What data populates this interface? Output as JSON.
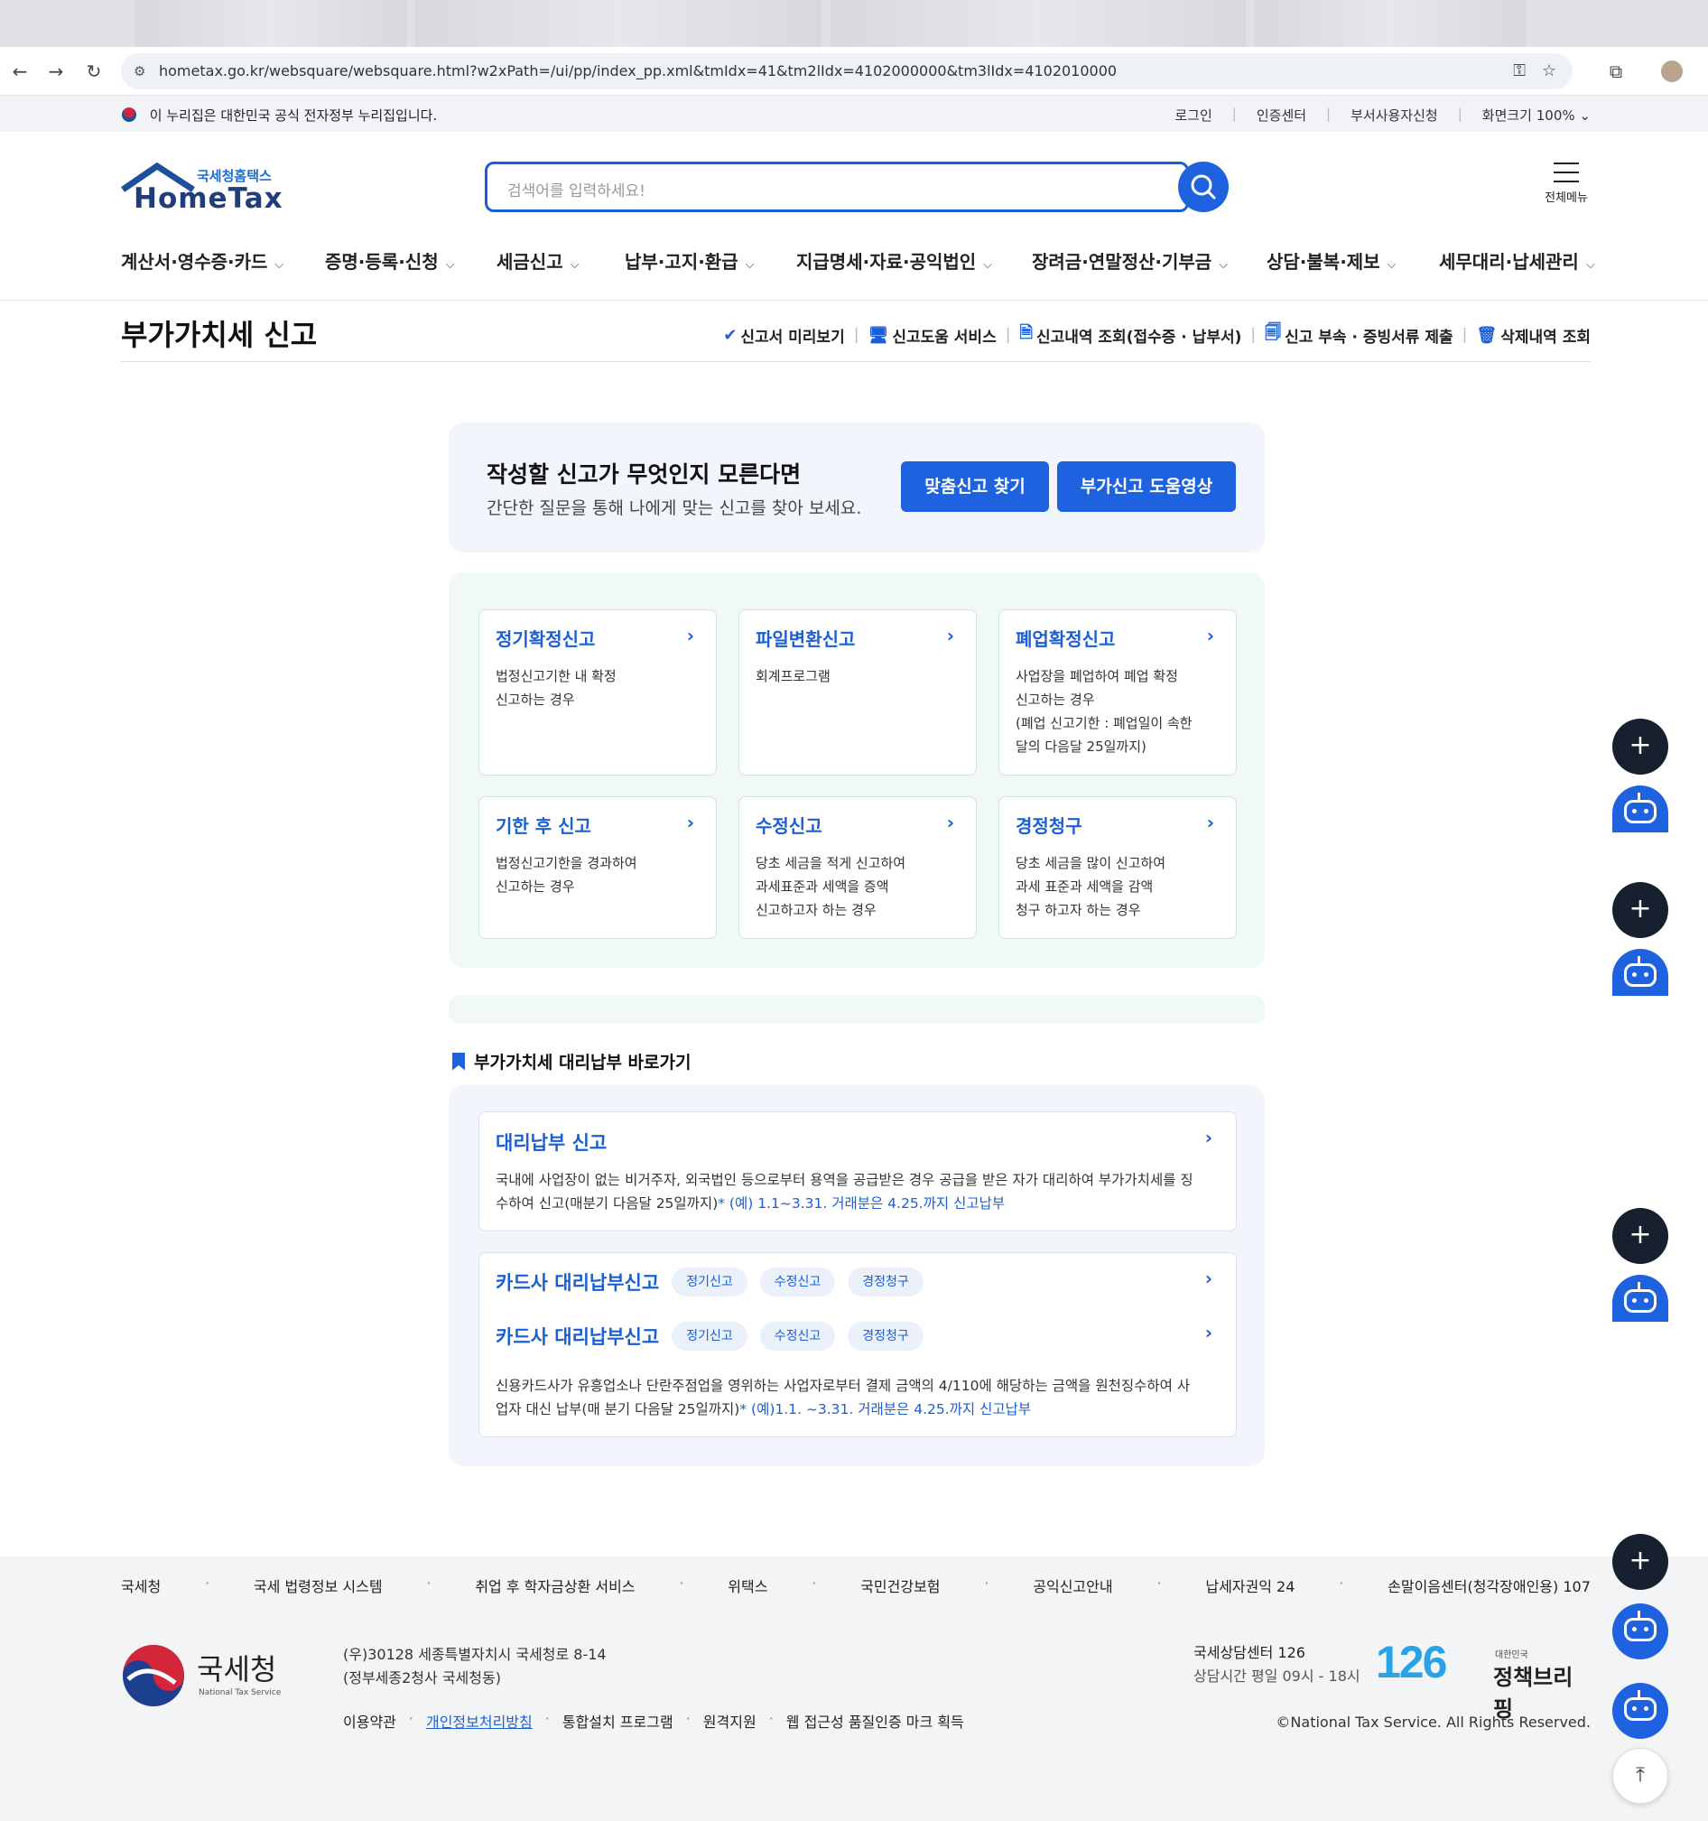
{
  "browser": {
    "url": "hometax.go.kr/websquare/websquare.html?w2xPath=/ui/pp/index_pp.xml&tmIdx=41&tm2lIdx=4102000000&tm3lIdx=4102010000"
  },
  "gov_banner": {
    "text": "이 누리집은 대한민국 공식 전자정부 누리집입니다.",
    "links": [
      "로그인",
      "인증센터",
      "부서사용자신청",
      "화면크기 100%"
    ]
  },
  "header": {
    "logo_sub": "국세청홈택스",
    "logo_main": "HomeTax",
    "search_placeholder": "검색어를 입력하세요!",
    "all_menu_label": "전체메뉴"
  },
  "gnb": [
    "계산서·영수증·카드",
    "증명·등록·신청",
    "세금신고",
    "납부·고지·환급",
    "지급명세·자료·공익법인",
    "장려금·연말정산·기부금",
    "상담·불복·제보",
    "세무대리·납세관리"
  ],
  "page": {
    "title": "부가가치세 신고",
    "title_links": [
      "신고서 미리보기",
      "신고도움 서비스",
      "신고내역 조회(접수증 · 납부서)",
      "신고 부속 · 증빙서류 제출",
      "삭제내역 조회"
    ]
  },
  "finder": {
    "heading": "작성할 신고가 무엇인지 모른다면",
    "desc": "간단한 질문을 통해 나에게 맞는 신고를 찾아 보세요.",
    "btn_find": "맞춤신고 찾기",
    "btn_video": "부가신고 도움영상"
  },
  "cards": [
    {
      "title": "정기확정신고",
      "desc": "법정신고기한 내 확정\n신고하는 경우"
    },
    {
      "title": "파일변환신고",
      "desc": "회계프로그램"
    },
    {
      "title": "폐업확정신고",
      "desc": "사업장을 폐업하여 폐업 확정\n신고하는 경우\n(폐업 신고기한 : 폐업일이 속한\n달의 다음달 25일까지)"
    },
    {
      "title": "기한 후 신고",
      "desc": "법정신고기한을 경과하여\n신고하는 경우"
    },
    {
      "title": "수정신고",
      "desc": "당초 세금을 적게 신고하여\n과세표준과 세액을 증액\n신고하고자 하는 경우"
    },
    {
      "title": "경정청구",
      "desc": "당초 세금을 많이 신고하여\n과세 표준과 세액을 감액\n청구 하고자 하는 경우"
    }
  ],
  "proxy": {
    "section_title": "부가가치세 대리납부 바로가기",
    "card1_title": "대리납부 신고",
    "card1_desc": "국내에 사업장이 없는 비거주자, 외국법인 등으로부터 용역을 공급받은 경우 공급을 받은 자가 대리하여 부가가치세를 징수하여 신고(매분기 다음달 25일까지)",
    "card1_hl": "* (예) 1.1~3.31. 거래분은 4.25.까지 신고납부",
    "card2_title_a": "카드사 대리납부신고",
    "card2_title_b": "카드사 대리납부신고",
    "chips": [
      "정기신고",
      "수정신고",
      "경정청구"
    ],
    "card2_desc": "신용카드사가 유흥업소나 단란주점업을 영위하는 사업자로부터 결제 금액의 4/110에 해당하는 금액을 원천징수하여 사업자 대신 납부(매 분기 다음달 25일까지)",
    "card2_hl": "* (예)1.1. ~3.31. 거래분은 4.25.까지 신고납부"
  },
  "footer": {
    "links": [
      "국세청",
      "국세 법령정보 시스템",
      "취업 후 학자금상환 서비스",
      "위택스",
      "국민건강보험",
      "공익신고안내",
      "납세자권익 24",
      "손말이음센터(청각장애인용) 107"
    ],
    "org_name": "국세청",
    "org_en": "National Tax Service",
    "addr1": "(우)30128 세종특별자치시 국세청로 8-14",
    "addr2": "(정부세종2청사 국세청동)",
    "menu": [
      "이용약관",
      "개인정보처리방침",
      "통합설치 프로그램",
      "원격지원",
      "웹 접근성 품질인증 마크 획득"
    ],
    "call_title": "국세상담센터 126",
    "call_hours": "상담시간 평일 09시 - 18시",
    "badge_126": "126",
    "brief_top": "대한민국",
    "brief_main": "정책브리핑",
    "copyright": "©National Tax Service. All Rights Reserved."
  }
}
